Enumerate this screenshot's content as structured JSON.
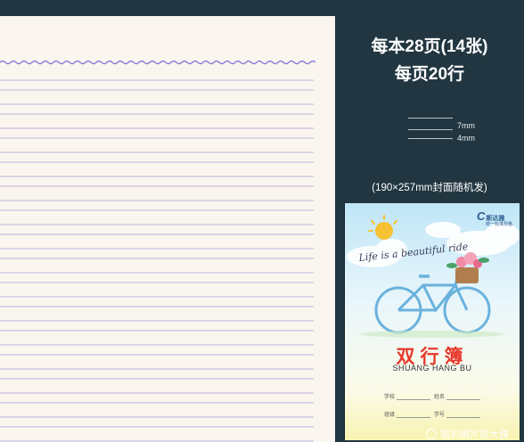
{
  "headline": {
    "line1": "每本28页(14张)",
    "line2": "每页20行"
  },
  "line_spacing_legend": {
    "upper": "7mm",
    "lower": "4mm"
  },
  "cover_note": "(190×257mm封面随机发)",
  "cover": {
    "brand_letter": "C",
    "brand_name": "斯达雅",
    "brand_sub": "统一标准规格",
    "script_text": "Life is a beautiful ride",
    "title_cn": "双行簿",
    "title_en": "SHUANG HANG BU",
    "fields": {
      "school": "学校",
      "name": "姓名",
      "class": "班级",
      "number": "学号"
    }
  },
  "watermark": "猎豹图片放大镜",
  "colors": {
    "background": "#213640",
    "paper": "#faf6ef",
    "ruling": "#8c7fd6",
    "title_red": "#e8382a",
    "bicycle_blue": "#6ab2dd"
  }
}
